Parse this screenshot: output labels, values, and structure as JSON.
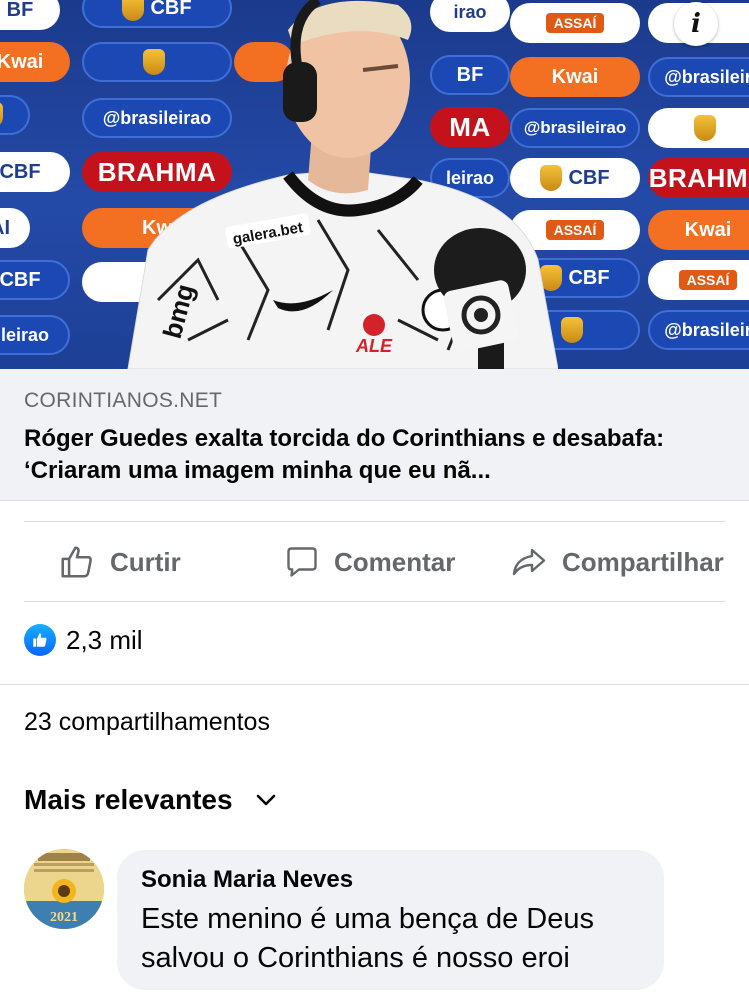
{
  "hero": {
    "sponsors": {
      "cbf": "CBF",
      "cbf_cut": "CBF",
      "kwai": "Kwai",
      "kwai_cut": "Kwai",
      "kwai_cut2": "Kw",
      "brasileirao": "@brasileirao",
      "brasileirao_cut": "@brasileira",
      "brasileirao_frag": "leirao",
      "brasileirao_frag2": "irao",
      "brasileirao_frag3": "eirao",
      "brahma": "BRAHMA",
      "brahma_cut": "BRAHMA",
      "brahma_frag": "MA",
      "assai": "ASSAÍ",
      "assai_frag": "AI",
      "bf_frag": "BF"
    },
    "shirt_sponsors": {
      "top": "galera.bet",
      "side": "bmg",
      "chest": "ALE"
    },
    "info_button": "i"
  },
  "link_preview": {
    "domain": "CORINTIANOS.NET",
    "title": "Róger Guedes exalta torcida do Corinthians e desabafa: ‘Criaram uma imagem minha que eu nã..."
  },
  "actions": {
    "like": "Curtir",
    "comment": "Comentar",
    "share": "Compartilhar"
  },
  "reactions": {
    "count": "2,3 mil"
  },
  "shares": {
    "text": "23 compartilhamentos"
  },
  "comments": {
    "sort_label": "Mais relevantes",
    "items": [
      {
        "author": "Sonia Maria Neves",
        "text": "Este menino é uma bença de Deus salvou o Corinthians é nosso eroi",
        "avatar_year": "2021"
      }
    ]
  },
  "colors": {
    "facebook_blue": "#0866ff",
    "secondary_text": "#65676b",
    "bubble_bg": "#f0f2f5",
    "brahma_red": "#c4121d",
    "kwai_orange": "#f36f21",
    "board_blue": "#244aa8"
  },
  "icons": {
    "like": "thumbs-up-icon",
    "comment": "speech-bubble-icon",
    "share": "share-arrow-icon",
    "reaction": "like-reaction-icon",
    "sort": "chevron-down-icon",
    "info": "info-icon"
  }
}
